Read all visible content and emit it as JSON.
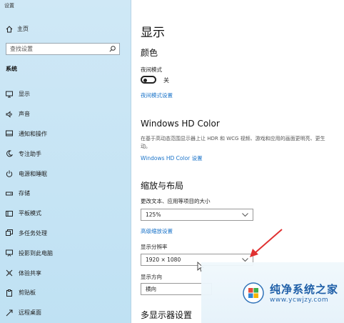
{
  "window": {
    "title": "设置"
  },
  "sidebar": {
    "home_label": "主页",
    "search_placeholder": "查找设置",
    "section_title": "系统",
    "items": [
      {
        "label": "显示",
        "icon": "monitor-icon"
      },
      {
        "label": "声音",
        "icon": "speaker-icon"
      },
      {
        "label": "通知和操作",
        "icon": "notification-icon"
      },
      {
        "label": "专注助手",
        "icon": "moon-icon"
      },
      {
        "label": "电源和睡眠",
        "icon": "power-icon"
      },
      {
        "label": "存储",
        "icon": "storage-icon"
      },
      {
        "label": "平板模式",
        "icon": "tablet-icon"
      },
      {
        "label": "多任务处理",
        "icon": "multitask-icon"
      },
      {
        "label": "投影到此电脑",
        "icon": "projector-icon"
      },
      {
        "label": "体验共享",
        "icon": "share-icon"
      },
      {
        "label": "剪贴板",
        "icon": "clipboard-icon"
      },
      {
        "label": "远程桌面",
        "icon": "remote-icon"
      }
    ]
  },
  "main": {
    "page_title": "显示",
    "color_heading": "颜色",
    "night_mode_label": "夜间模式",
    "night_mode_state": "关",
    "night_mode_link": "夜间模式设置",
    "hd_heading": "Windows HD Color",
    "hd_desc": "在基于高动态范围显示器上让 HDR 和 WCG 视频、游戏和应用的画面更明亮、更生动。",
    "hd_link": "Windows HD Color 设置",
    "scale_heading": "缩放与布局",
    "scale_label": "更改文本、应用等项目的大小",
    "scale_value": "125%",
    "advanced_scale_link": "高级缩放设置",
    "resolution_label": "显示分辨率",
    "resolution_value": "1920 × 1080",
    "orientation_label": "显示方向",
    "orientation_value": "横向",
    "multi_display_heading": "多显示器设置"
  },
  "watermark": {
    "title": "纯净系统之家",
    "url": "www.ycwjzy.com"
  },
  "colors": {
    "accent": "#1a73c9",
    "annotation": "#e03131",
    "sidebar_bg": "#c6e4f4"
  }
}
